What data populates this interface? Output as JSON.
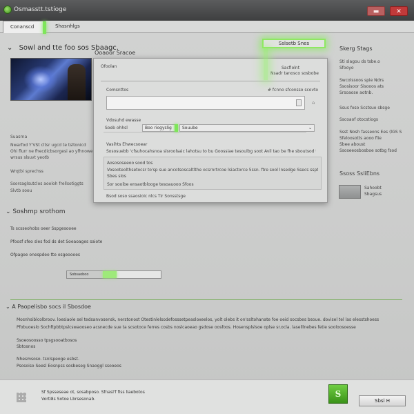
{
  "window": {
    "title": "Osmasstt.tstioge",
    "minimize_label": "",
    "close_label": "",
    "colors": {
      "accent": "#7ee65a",
      "title_bar": "#4a4b4c",
      "close": "#c23a3a"
    }
  },
  "tabs": [
    {
      "label": "Conanscd",
      "active": true
    },
    {
      "label": "Shasnhlgs",
      "active": false
    }
  ],
  "main": {
    "heading": "Sowl and tte foo sos Sbaagc.",
    "left_text": [
      "Suasrna",
      "Nwarfod Y'VSt cltsr ugcd te tsltonicd",
      "Ohi flurr ne fhecdicbsorgesi ao yfhnowe",
      "wrsus slsuvt yeotb",
      "Wrqtbi sprechss",
      "Ssorsaglsutclos aooloh frellsotiggts",
      "Slvtb soou"
    ]
  },
  "highlight_button": {
    "label": "Sslsetb Snes"
  },
  "panel_tab": {
    "label": "Ooaoor Sracoe"
  },
  "dialog": {
    "label_top": "Ofoolan",
    "label_field": "Comsnttos",
    "label_field_right": "# fcnno sfconsso scovto",
    "label_top_right": "Sacfiolnt",
    "label_top_right_sub": "Nsadr tanosco sosbobe",
    "label_select_head": "Vdosuhd ewasse",
    "select_label": "Soeb ohhsl",
    "select_value1": "Boo riogyslig",
    "select_value2": "Souube",
    "section_label": "Vasihts Ehwecsoear",
    "section_text": "Sososuebb 'cfsuhocahsnoa slsroolsaic lahotsu to bu Goossiae tesoulbg soot Avil tao be fhe sboutsod to ose Ti soedaa",
    "box_title": "Aosososeeoo sood tos",
    "box_line1": "Vosooteolthsetocsr to'sp sue ancotsoscaltlthe ocsrnrtrcoe lsiactorce 5ssn. ftre sool lnsedge Ssecs sspte chsuss ese ase Sbe",
    "box_line2": "Sbes slos",
    "box_line3": "Sor sooibe ensaotblooge tesoauooo Sfoos",
    "footer_text": "Bsod soso ssaosioic nlcs Tir Sonsstsge"
  },
  "right_sidebar": {
    "title": "Skerg Stags",
    "lines": [
      "Sti slagou ds tsbe.o",
      "Sfooyo",
      "Swcolssoos spie Ndrs",
      "Ssosisoor Sisooos ats",
      "Srsoaose aotnb.",
      "Ssus foso Scstsuo sbsge",
      "Sscoaof otocstiogs",
      "Ssst Nosh fasseons Ees (lGS S",
      "Sfeloosotts aooo flie",
      "Sbee aboust",
      "Ssoseeosbosboe sotbg fsod"
    ],
    "subheading": "Ssoss SsliEbns",
    "thumb_text1": "Sahoobt",
    "thumb_text2": "Sbagsus"
  },
  "sections": {
    "setup_heading": "Soshmp srothom",
    "setup_lines": [
      "Ts scsseohobs oeer Sspgesooee",
      "Pfoosf sfeo sles fod ds det Soeaoages saiote",
      "Ofpagoe onespdeo tte osgeoooes"
    ],
    "slider_label": "Sobsaoboo",
    "slider_value_pct": 38,
    "about_heading": "A Paopelisbo socs il Sbosdoe",
    "about_lines": [
      "Mosnhsiblcolbroov. loesiaole sel tedsanvosensk, nerstonost Otestinlelsodefosssetpeasloxeelos, yolt olebs it on'ssltohanate foe oeid socsbes bsoue. dovisel tel las elesstshoess",
      "Pfobuoeslo Sochftpbbtpslcswaooseo acsnecde sue ta scsotoce ferres cosbs noslcaoeao gsdose oosfoos. Hosensplslsoe oplse sr.ocla. laselllnebes fetie sooloosoesse",
      "Ssoeosoosso tpsgsooatbosos",
      "Sbtosnos",
      "Nhesmsoso. tsnlspeoge esbst.",
      "Psosoiso Seesl Eosnpss sosbeseg Snaoggl ssooeos"
    ]
  },
  "footer": {
    "line1": "Sf Spsseseae ot, sosabposo. Sfnasl'f fiss liaebotos",
    "line2": "Vorti8s Sotoe Lbrsesonab.",
    "logo_glyph": "S",
    "button_label": "Sbsl H"
  }
}
